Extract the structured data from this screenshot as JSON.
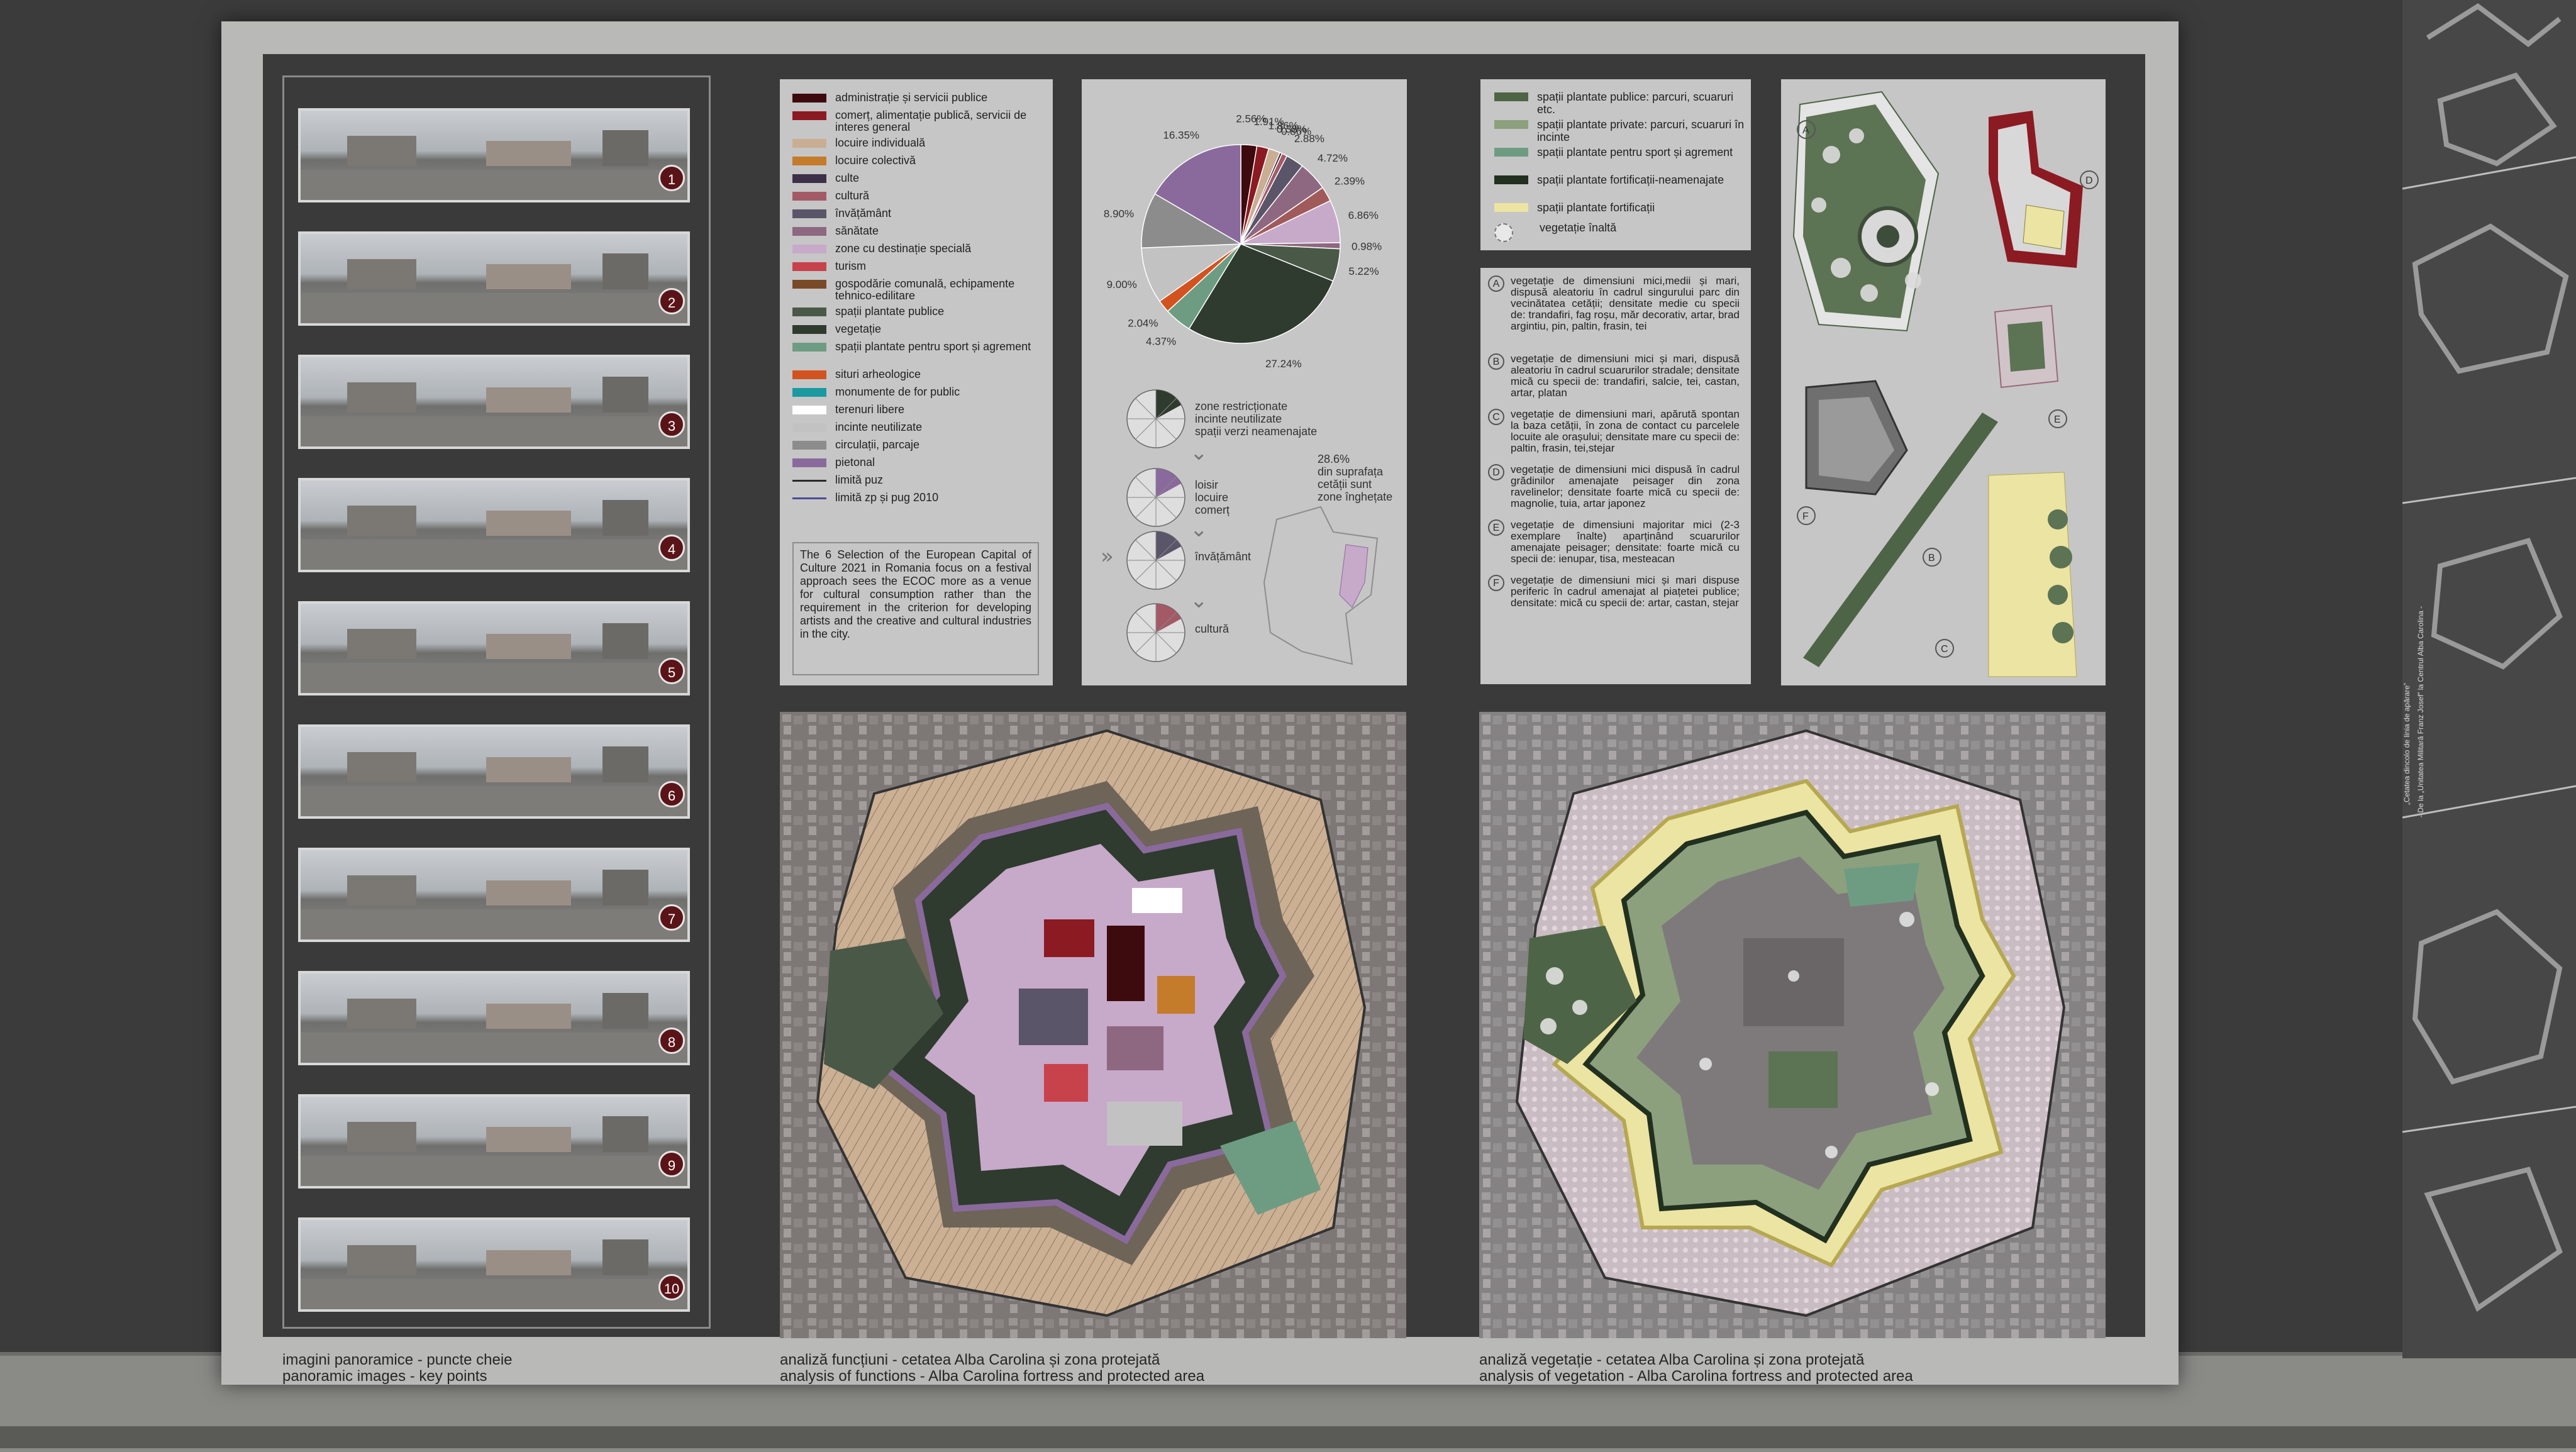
{
  "panoramas": {
    "items": [
      "1",
      "2",
      "3",
      "4",
      "5",
      "6",
      "7",
      "8",
      "9",
      "10"
    ],
    "caption_ro": "imagini panoramice - puncte cheie",
    "caption_en": "panoramic images - key points"
  },
  "functions": {
    "legend": [
      {
        "label": "administrație și servicii publice",
        "color": "#3d0a0e"
      },
      {
        "label": "comerț, alimentație publică, servicii de interes general",
        "color": "#8b1a22"
      },
      {
        "label": "locuire individuală",
        "color": "#c9ae93"
      },
      {
        "label": "locuire colectivă",
        "color": "#c47b2a"
      },
      {
        "label": "culte",
        "color": "#3e3048"
      },
      {
        "label": "cultură",
        "color": "#a35a66"
      },
      {
        "label": "învățământ",
        "color": "#5a5568"
      },
      {
        "label": "sănătate",
        "color": "#8d6880"
      },
      {
        "label": "zone cu destinație specială",
        "color": "#c7a9c9"
      },
      {
        "label": "turism",
        "color": "#c8424c"
      },
      {
        "label": "gospodărie comunală, echipamente tehnico-edilitare",
        "color": "#7a4a28"
      },
      {
        "label": "spații plantate publice",
        "color": "#4a5848"
      },
      {
        "label": "vegetație",
        "color": "#2e3b2e"
      },
      {
        "label": "spații plantate pentru sport și agrement",
        "color": "#6e9c82"
      },
      {
        "label": "situri arheologice",
        "color": "#d2531f"
      },
      {
        "label": "monumente de for public",
        "color": "#1a9aa0"
      },
      {
        "label": "terenuri libere",
        "color": "#ffffff"
      },
      {
        "label": "incinte neutilizate",
        "color": "#c2c2c2"
      },
      {
        "label": "circulații, parcaje",
        "color": "#8c8c8c"
      },
      {
        "label": "pietonal",
        "color": "#8a6a9c"
      },
      {
        "label": "limită puz",
        "color": "#2a2a2a"
      },
      {
        "label": "limită zp și pug 2010",
        "color": "#4a4a9a"
      }
    ],
    "quote": "The 6 Selection of the European Capital of Culture 2021 in Romania focus on a festival approach sees the ECOC more as a venue for cultural consumption rather than the requirement in the criterion for developing artists and the creative and cultural industries in the city.",
    "caption_ro": "analiză funcțiuni - cetatea Alba Carolina și zona protejată",
    "caption_en": "analysis of functions - Alba Carolina fortress and protected area"
  },
  "chart_data": {
    "type": "pie",
    "slices": [
      {
        "label": "2.56%",
        "value": 2.56,
        "color": "#3d0a0e"
      },
      {
        "label": "1.91%",
        "value": 1.91,
        "color": "#8b1a22"
      },
      {
        "label": "1.86%",
        "value": 1.86,
        "color": "#c9ae93"
      },
      {
        "label": "0.38%",
        "value": 0.38,
        "color": "#3e3048"
      },
      {
        "label": "0.86%",
        "value": 0.86,
        "color": "#a35a66"
      },
      {
        "label": "2.88%",
        "value": 2.88,
        "color": "#5a5568"
      },
      {
        "label": "4.72%",
        "value": 4.72,
        "color": "#8d6880"
      },
      {
        "label": "2.39%",
        "value": 2.39,
        "color": "#a05a5a"
      },
      {
        "label": "6.86%",
        "value": 6.86,
        "color": "#c7a9c9"
      },
      {
        "label": "0.98%",
        "value": 0.98,
        "color": "#8d6880"
      },
      {
        "label": "5.22%",
        "value": 5.22,
        "color": "#4a5848"
      },
      {
        "label": "27.24%",
        "value": 27.24,
        "color": "#2e3b2e"
      },
      {
        "label": "4.37%",
        "value": 4.37,
        "color": "#6e9c82"
      },
      {
        "label": "2.04%",
        "value": 2.04,
        "color": "#d2531f"
      },
      {
        "label": "9.00%",
        "value": 9.0,
        "color": "#c2c2c2"
      },
      {
        "label": "8.90%",
        "value": 8.9,
        "color": "#8c8c8c"
      },
      {
        "label": "16.35%",
        "value": 16.35,
        "color": "#8a6a9c"
      }
    ]
  },
  "mini_pies": {
    "labels": [
      "zone restricționate incinte neutilizate spații verzi neamenajate",
      "loisir locuire comerț",
      "învățământ",
      "cultură"
    ],
    "note": "28.6% din suprafața cetății sunt zone înghețate"
  },
  "vegetation": {
    "legend": [
      {
        "label": "spații plantate publice: parcuri, scuaruri etc.",
        "color": "#4e6446"
      },
      {
        "label": "spații plantate private: parcuri, scuaruri în incinte",
        "color": "#8ca07e"
      },
      {
        "label": "spații plantate pentru sport și agrement",
        "color": "#6e9c82"
      },
      {
        "label": "spații plantate fortificații-neamenajate",
        "color": "#22301f"
      },
      {
        "label": "spații plantate fortificații",
        "color": "#ece4a2"
      },
      {
        "label": "vegetație înaltă",
        "color": "#e8e8e8"
      }
    ],
    "descriptions": [
      {
        "letter": "A",
        "text": "vegetație de dimensiuni mici,medii și mari, dispusă aleatoriu în cadrul singurului parc din vecinătatea cetății; densitate medie cu specii de: trandafiri, fag roșu, măr decorativ, artar, brad argintiu, pin, paltin, frasin, tei"
      },
      {
        "letter": "B",
        "text": "vegetație de dimensiuni mici și mari, dispusă aleatoriu în cadrul scuarurilor stradale; densitate mică cu specii de: trandafiri, salcie, tei, castan, artar, platan"
      },
      {
        "letter": "C",
        "text": "vegetație de dimensiuni mari, apărută spontan la baza cetății, în zona de contact cu parcelele locuite ale orașului; densitate mare cu specii de: paltin, frasin, tei,stejar"
      },
      {
        "letter": "D",
        "text": "vegetație de dimensiuni mici dispusă în cadrul grădinilor amenajate peisager din zona ravelinelor; densitate foarte mică cu specii de: magnolie, tuia, artar japonez"
      },
      {
        "letter": "E",
        "text": "vegetație de dimensiuni majoritar mici (2-3 exemplare înalte) aparținând scuarurilor amenajate peisager; densitate: foarte mică cu specii de: ienupar, tisa, mesteacan"
      },
      {
        "letter": "F",
        "text": "vegetație de dimensiuni mici și mari dispuse periferic în cadrul amenajat al piațetei publice; densitate: mică cu specii de: artar, castan, stejar"
      }
    ],
    "detail_letters": [
      "A",
      "D",
      "E",
      "F",
      "B",
      "C"
    ],
    "caption_ro": "analiză vegetație - cetatea Alba Carolina și zona protejată",
    "caption_en": "analysis of vegetation - Alba Carolina fortress and protected area"
  },
  "side_panel": {
    "line1": "„Cetatea dincolo de linia de apărare”",
    "line2": "- De la „Unitatea Militară Franz Josef” la Centrul Alba Carolina -"
  }
}
